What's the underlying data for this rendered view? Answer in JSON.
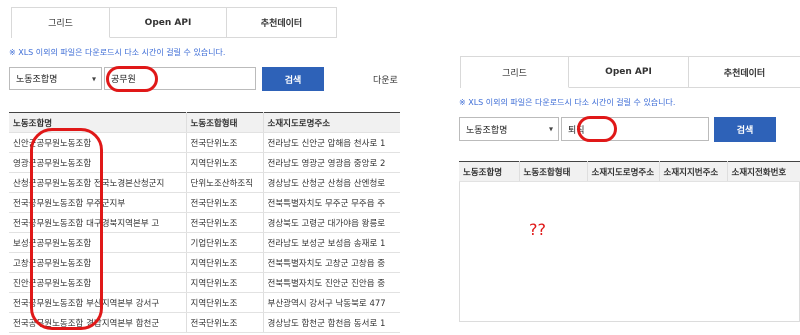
{
  "left": {
    "tabs": [
      {
        "label": "그리드"
      },
      {
        "label": "Open API"
      },
      {
        "label": "추천데이터"
      }
    ],
    "notice": "※ XLS 이외의 파일은 다운로드시 다소 시간이 걸릴 수 있습니다.",
    "search": {
      "select_value": "노동조합명",
      "input_value": "공무원",
      "button_label": "검색",
      "download_label": "다운로"
    },
    "table": {
      "headers": [
        "노동조합명",
        "노동조합형태",
        "소재지도로명주소"
      ],
      "rows": [
        [
          "신안군공무원노동조합",
          "전국단위노조",
          "전라남도 신안군 압해읍 천사로 1"
        ],
        [
          "영광군공무원노동조합",
          "지역단위노조",
          "전라남도 영광군 영광읍 중앙로 2"
        ],
        [
          "산청군공무원노동조합 전국노경본산청군지",
          "단위노조산하조직",
          "경상남도 산청군 산청읍 산엔청로"
        ],
        [
          "전국공무원노동조합 무주군지부",
          "전국단위노조",
          "전북특별자치도 무주군 무주읍 주"
        ],
        [
          "전국공무원노동조합 대구경북지역본부 고",
          "전국단위노조",
          "경상북도 고령군 대가야읍 왕릉로"
        ],
        [
          "보성군공무원노동조합",
          "기업단위노조",
          "전라남도 보성군 보성읍 송재로 1"
        ],
        [
          "고창군공무원노동조합",
          "지역단위노조",
          "전북특별자치도 고창군 고창읍 중"
        ],
        [
          "진안군공무원노동조합",
          "지역단위노조",
          "전북특별자치도 진안군 진안읍 중"
        ],
        [
          "전국공무원노동조합 부산지역본부 강서구",
          "지역단위노조",
          "부산광역시 강서구 낙동북로 477"
        ],
        [
          "전국공무원노동조합 경남지역본부 합천군",
          "전국단위노조",
          "경상남도 합천군 합천읍 동서로 1"
        ]
      ]
    }
  },
  "right": {
    "tabs": [
      {
        "label": "그리드"
      },
      {
        "label": "Open API"
      },
      {
        "label": "추천데이터"
      }
    ],
    "notice": "※ XLS 이외의 파일은 다운로드시 다소 시간이 걸릴 수 있습니다.",
    "search": {
      "select_value": "노동조합명",
      "input_value": "퇴직",
      "button_label": "검색"
    },
    "table": {
      "headers": [
        "노동조합명",
        "노동조합형태",
        "소재지도로명주소",
        "소재지지번주소",
        "소재지전화번호"
      ]
    },
    "annotation": "??"
  },
  "colors": {
    "accent": "#2e62b8",
    "notice": "#3b6bd6",
    "highlight": "#e01818"
  }
}
